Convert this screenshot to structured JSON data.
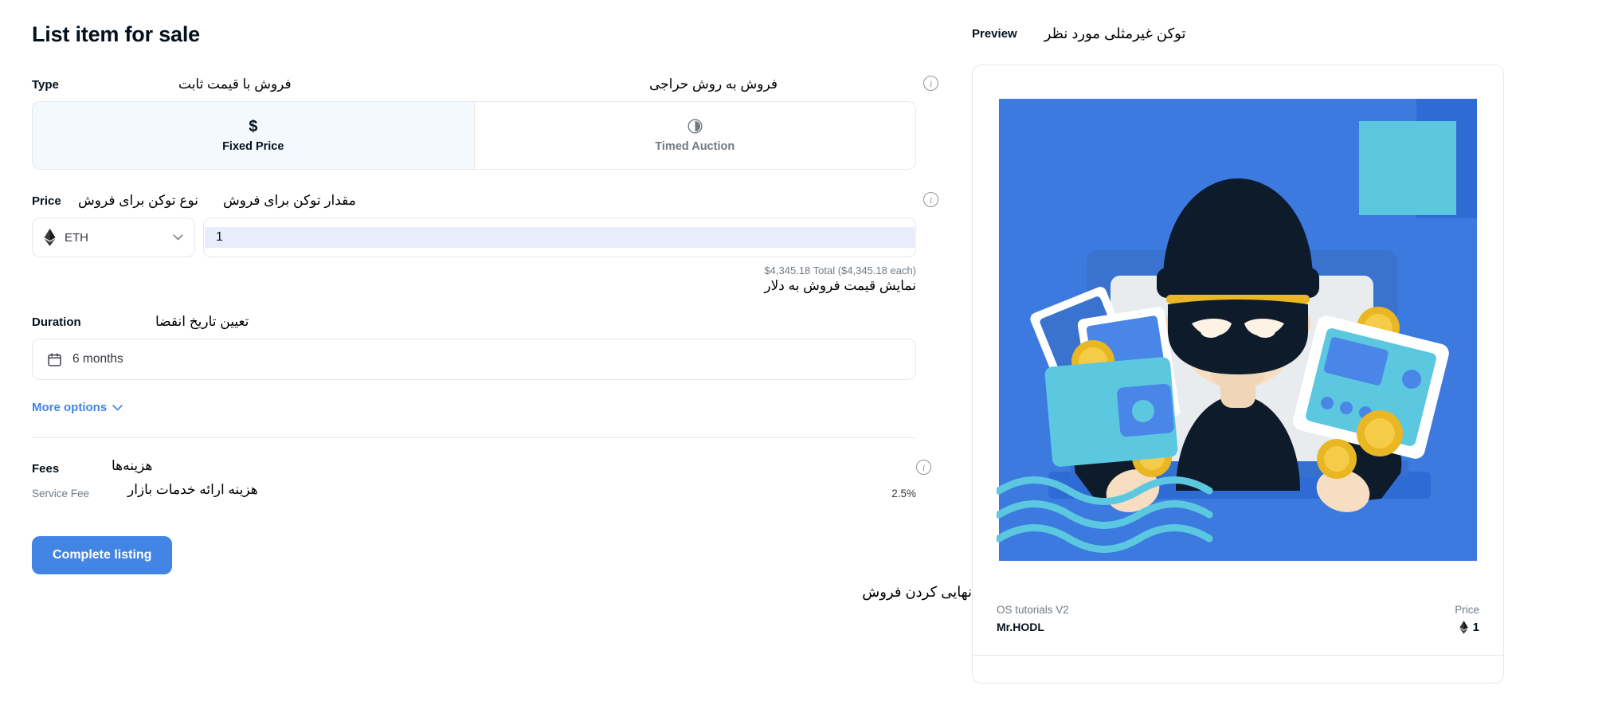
{
  "page": {
    "title": "List item for sale"
  },
  "type_section": {
    "label": "Type",
    "note_fixed": "فروش با قیمت ثابت",
    "note_auction": "فروش به روش حراجی",
    "info_icon": "info-circle-icon",
    "options": [
      {
        "id": "fixed-price",
        "label": "Fixed Price",
        "glyph": "$",
        "icon": "dollar-icon",
        "active": true
      },
      {
        "id": "timed-auction",
        "label": "Timed Auction",
        "glyph": "",
        "icon": "clock-icon",
        "active": false
      }
    ]
  },
  "price_section": {
    "label": "Price",
    "note_amount": "مقدار توکن برای فروش",
    "note_token_type": "نوع توکن برای فروش",
    "info_icon": "info-circle-icon",
    "currency": {
      "value": "ETH",
      "icon": "ethereum-diamond-icon",
      "chevron": "chevron-down-icon"
    },
    "amount": {
      "value": "1",
      "placeholder": "Amount"
    },
    "total_text": "$4,345.18 Total ($4,345.18 each)",
    "total_note": "نمایش قیمت فروش به دلار"
  },
  "duration_section": {
    "label": "Duration",
    "note": "تعیین تاریخ انقضا",
    "value": "6 months",
    "icon": "calendar-icon"
  },
  "more_options": {
    "label": "More options",
    "chevron": "chevron-down-icon"
  },
  "fees_section": {
    "title": "Fees",
    "title_note": "هزینه‌ها",
    "info_icon": "info-circle-icon",
    "rows": [
      {
        "label": "Service Fee",
        "note": "هزینه ارائه خدمات بازار",
        "value": "2.5%"
      }
    ]
  },
  "cta": {
    "label": "Complete listing",
    "note": "نهایی کردن فروش"
  },
  "preview": {
    "label": "Preview",
    "note": "توکن غیرمثلی مورد نظر",
    "card": {
      "artwork_name": "masked-thief-with-cards-and-coins-illustration",
      "collection": "OS tutorials V2",
      "name": "Mr.HODL",
      "price_label": "Price",
      "price_value": "1",
      "price_icon": "ethereum-diamond-icon"
    }
  },
  "colors": {
    "accent": "#4285e4",
    "active_tab_bg": "#f4f9fd",
    "border": "#e5e8eb",
    "muted_text": "#707a83",
    "input_selection": "#e8edfb",
    "art_bg": "#3d7ae0",
    "art_cyan": "#5bc8e0",
    "art_gold": "#e8b723",
    "art_dark": "#0d1b2b"
  }
}
